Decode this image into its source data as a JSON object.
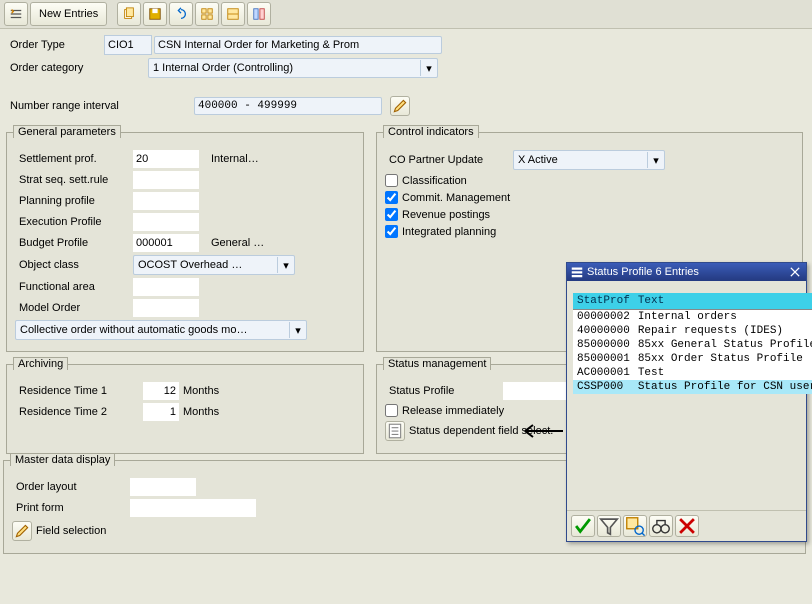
{
  "toolbar": {
    "new_entries": "New Entries"
  },
  "header": {
    "order_type_lbl": "Order Type",
    "order_type_val": "CIO1",
    "order_type_desc": "CSN Internal Order for Marketing & Prom",
    "order_cat_lbl": "Order category",
    "order_cat_val": "1 Internal Order (Controlling)",
    "nri_lbl": "Number range interval",
    "nri_val": "400000 - 499999"
  },
  "general": {
    "legend": "General parameters",
    "settlement_lbl": "Settlement prof.",
    "settlement_val": "20",
    "settlement_desc": "Internal…",
    "strat_lbl": "Strat seq. sett.rule",
    "planning_lbl": "Planning profile",
    "exec_lbl": "Execution Profile",
    "budget_lbl": "Budget Profile",
    "budget_val": "000001",
    "budget_desc": "General …",
    "objclass_lbl": "Object class",
    "objclass_val": "OCOST Overhead …",
    "funcarea_lbl": "Functional area",
    "model_lbl": "Model Order",
    "collective_val": "Collective order without automatic goods mo…"
  },
  "control": {
    "legend": "Control indicators",
    "copartner_lbl": "CO Partner Update",
    "copartner_val": "X Active",
    "classification": "Classification",
    "commit": "Commit. Management",
    "revenue": "Revenue postings",
    "integrated": "Integrated planning"
  },
  "archiving": {
    "legend": "Archiving",
    "res1_lbl": "Residence Time 1",
    "res1_val": "12",
    "res1_unit": "Months",
    "res2_lbl": "Residence Time 2",
    "res2_val": "1",
    "res2_unit": "Months"
  },
  "status": {
    "legend": "Status management",
    "profile_lbl": "Status Profile",
    "profile_val": "",
    "release": "Release immediately",
    "dependent": "Status dependent field select."
  },
  "master": {
    "legend": "Master data display",
    "layout_lbl": "Order layout",
    "print_lbl": "Print form",
    "fieldsel": "Field selection"
  },
  "popup": {
    "title": "Status Profile 6 Entries",
    "col1": "StatProf",
    "col2": "Text",
    "rows": [
      {
        "p": "00000002",
        "t": "Internal orders"
      },
      {
        "p": "40000000",
        "t": "Repair requests        (IDES)"
      },
      {
        "p": "85000000",
        "t": "85xx General Status Profile"
      },
      {
        "p": "85000001",
        "t": "85xx Order Status Profile"
      },
      {
        "p": "AC000001",
        "t": "Test"
      },
      {
        "p": "CSSP000",
        "t": "Status Profile for CSN user"
      }
    ]
  }
}
